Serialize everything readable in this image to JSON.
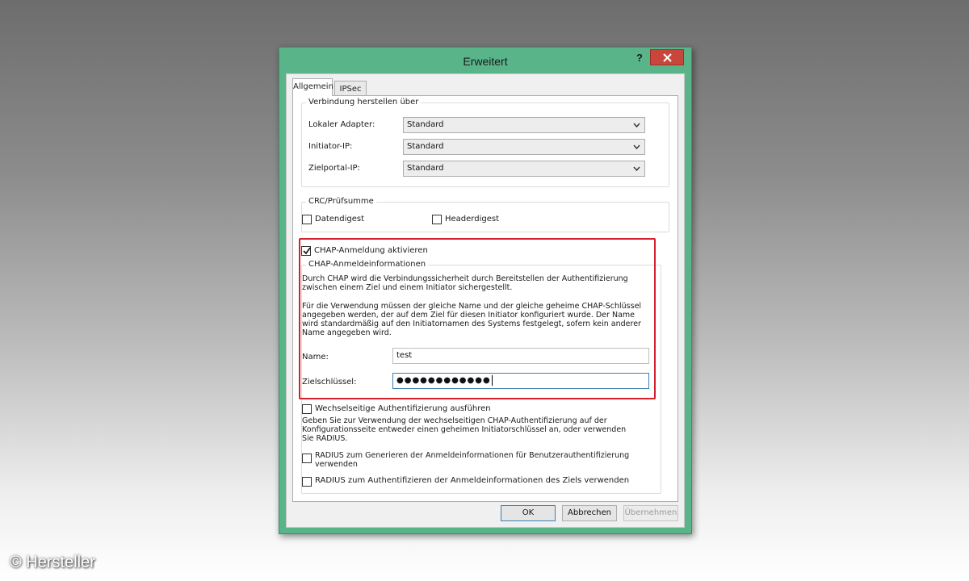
{
  "window": {
    "title": "Erweitert",
    "help_label": "?",
    "accent": "#5ab48a",
    "close_color": "#c9463d"
  },
  "tabs": [
    {
      "label": "Allgemein",
      "active": true
    },
    {
      "label": "IPSec",
      "active": false
    }
  ],
  "connection_group": {
    "title": "Verbindung herstellen über",
    "fields": [
      {
        "label": "Lokaler Adapter:",
        "value": "Standard"
      },
      {
        "label": "Initiator-IP:",
        "value": "Standard"
      },
      {
        "label": "Zielportal-IP:",
        "value": "Standard"
      }
    ]
  },
  "crc_group": {
    "title": "CRC/Prüfsumme",
    "data_digest": {
      "label": "Datendigest",
      "checked": false
    },
    "header_digest": {
      "label": "Headerdigest",
      "checked": false
    }
  },
  "chap": {
    "enable": {
      "label": "CHAP-Anmeldung aktivieren",
      "checked": true
    },
    "group_title": "CHAP-Anmeldeinformationen",
    "description1": "Durch CHAP wird die Verbindungssicherheit durch Bereitstellen der Authentifizierung zwischen einem Ziel und einem Initiator sichergestellt.",
    "description2": "Für die Verwendung müssen der gleiche Name und der gleiche geheime CHAP-Schlüssel angegeben werden, der auf dem Ziel für diesen Initiator konfiguriert wurde. Der Name wird standardmäßig auf den Initiatornamen des Systems festgelegt, sofern kein anderer Name angegeben wird.",
    "name_label": "Name:",
    "name_value": "test",
    "secret_label": "Zielschlüssel:",
    "secret_value": "●●●●●●●●●●●●",
    "highlight_color": "#d4202a"
  },
  "mutual": {
    "label": "Wechselseitige Authentifizierung ausführen",
    "checked": false,
    "description": "Geben Sie zur Verwendung der wechselseitigen CHAP-Authentifizierung auf der Konfigurationsseite entweder einen geheimen Initiatorschlüssel an, oder verwenden Sie RADIUS.",
    "radius_generate": {
      "label": "RADIUS zum Generieren der Anmeldeinformationen für Benutzerauthentifizierung verwenden",
      "checked": false
    },
    "radius_authenticate": {
      "label": "RADIUS zum Authentifizieren der Anmeldeinformationen des Ziels verwenden",
      "checked": false
    }
  },
  "buttons": {
    "ok": "OK",
    "cancel": "Abbrechen",
    "apply": "Übernehmen"
  },
  "watermark": "© Hersteller"
}
